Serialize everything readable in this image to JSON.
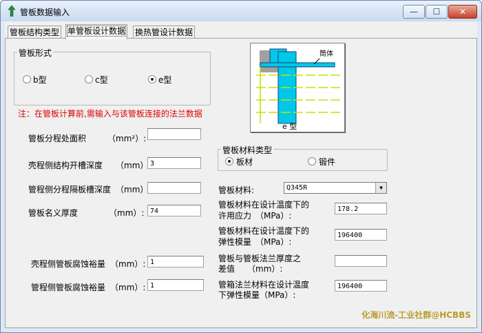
{
  "window": {
    "title": "管板数据输入",
    "min_glyph": "—",
    "max_glyph": "☐",
    "close_glyph": "✕"
  },
  "tabs": [
    {
      "label": "管板结构类型"
    },
    {
      "label": "单管板设计数据"
    },
    {
      "label": "换热管设计数据"
    }
  ],
  "tube_form": {
    "title": "管板形式",
    "options": [
      {
        "label": "b型",
        "selected": false
      },
      {
        "label": "c型",
        "selected": false
      },
      {
        "label": "e型",
        "selected": true
      }
    ]
  },
  "note": "注：在管板计算前,需输入与该管板连接的法兰数据",
  "diagram": {
    "shell_label": "筒体",
    "caption": "e 型"
  },
  "fields_left": [
    {
      "label": "管板分程处面积",
      "unit": "（mm²）:",
      "value": ""
    },
    {
      "label": "壳程侧结构开槽深度",
      "unit": "（mm）:",
      "value": "3"
    },
    {
      "label": "管程侧分程隔板槽深度",
      "unit": "（mm）:",
      "value": ""
    },
    {
      "label": "管板名义厚度",
      "unit": "（mm）:",
      "value": "74"
    },
    {
      "label": "壳程侧管板腐蚀裕量",
      "unit": "（mm）:",
      "value": "1"
    },
    {
      "label": "管程侧管板腐蚀裕量",
      "unit": "（mm）:",
      "value": "1"
    }
  ],
  "material_type": {
    "title": "管板材料类型",
    "options": [
      {
        "label": "板材",
        "selected": true
      },
      {
        "label": "锻件",
        "selected": false
      }
    ]
  },
  "material": {
    "label": "管板材料:",
    "value": "Q345R"
  },
  "fields_right": [
    {
      "label1": "管板材料在设计温度下的",
      "label2": "许用应力　（MPa）:",
      "value": "178.2"
    },
    {
      "label1": "管板材料在设计温度下的",
      "label2": "弹性模量　（MPa）:",
      "value": "196400"
    },
    {
      "label1": "管板与管板法兰厚度之",
      "label2": "差值　　（mm）:",
      "value": ""
    },
    {
      "label1": "管箱法兰材料在设计温度",
      "label2": "下弹性模量（MPa）:",
      "value": "196400"
    }
  ],
  "watermark": "化海川流-工业社群@HCBBS",
  "colors": {
    "note": "#e00000",
    "diagram_fill": "#00c8e8",
    "diagram_line": "#c8e000"
  }
}
